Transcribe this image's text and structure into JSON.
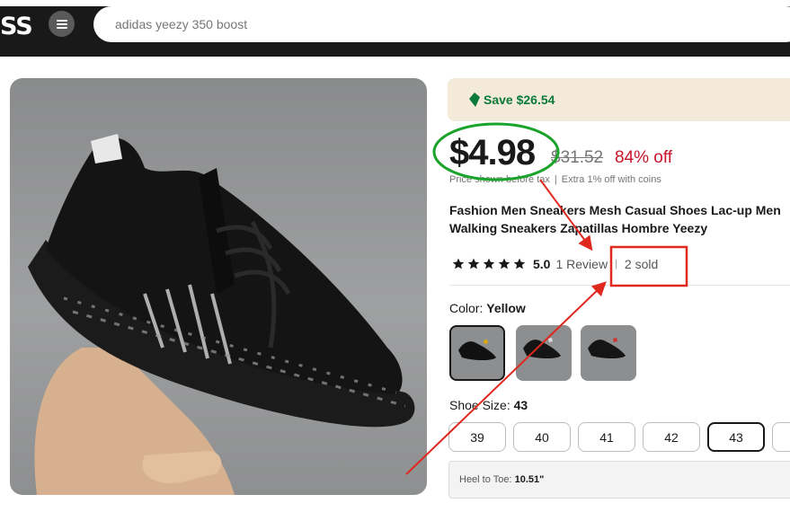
{
  "header": {
    "logo": "SS",
    "search_placeholder": "adidas yeezy 350 boost"
  },
  "product": {
    "save_text": "Save $26.54",
    "price": "$4.98",
    "original_price": "$31.52",
    "discount": "84% off",
    "price_note_1": "Price shown before tax",
    "price_note_2": "Extra 1% off with coins",
    "title": "Fashion Men Sneakers Mesh Casual Shoes Lac-up Men Walking Sneakers Zapatillas Hombre Yeezy",
    "rating": {
      "stars": 5,
      "score": "5.0",
      "reviews": "1 Review",
      "sold": "2 sold"
    },
    "color": {
      "label": "Color:",
      "selected": "Yellow"
    },
    "size": {
      "label": "Shoe Size:",
      "selected": "43",
      "options": [
        "39",
        "40",
        "41",
        "42",
        "43"
      ]
    },
    "fit": {
      "label": "Heel to Toe:",
      "value": "10.51\""
    }
  },
  "colors": {
    "save_green": "#0a7a3a",
    "discount_red": "#c7152a",
    "annotation_green": "#1aa32a",
    "annotation_red": "#e0281f"
  }
}
